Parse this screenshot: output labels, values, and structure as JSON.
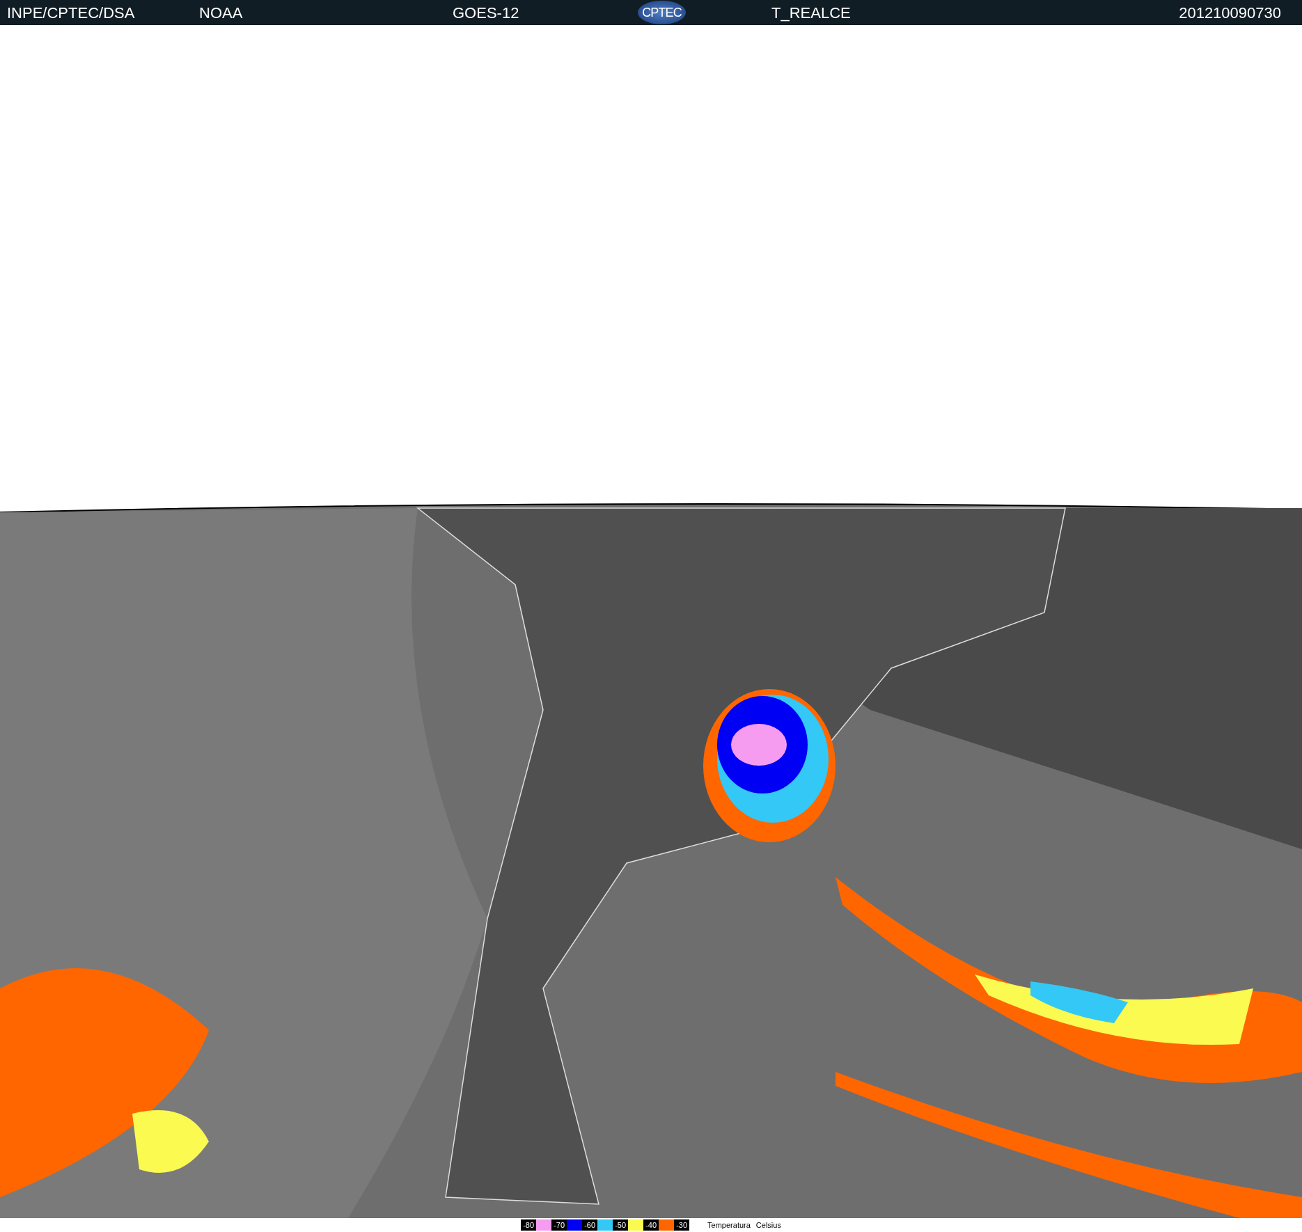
{
  "header": {
    "source": "INPE/CPTEC/DSA",
    "agency": "NOAA",
    "satellite": "GOES-12",
    "logo": "CPTEC",
    "product": "T_REALCE",
    "timestamp": "201210090730"
  },
  "legend": {
    "items": [
      {
        "label": "-80",
        "color": "#f59cf0"
      },
      {
        "label": "-70",
        "color": "#0000f5"
      },
      {
        "label": "-60",
        "color": "#33c8f5"
      },
      {
        "label": "-50",
        "color": "#fafa50"
      },
      {
        "label": "-40",
        "color": "#ff6600"
      },
      {
        "label": "-30"
      }
    ],
    "title": "Temperatura",
    "unit": "Celsius"
  }
}
